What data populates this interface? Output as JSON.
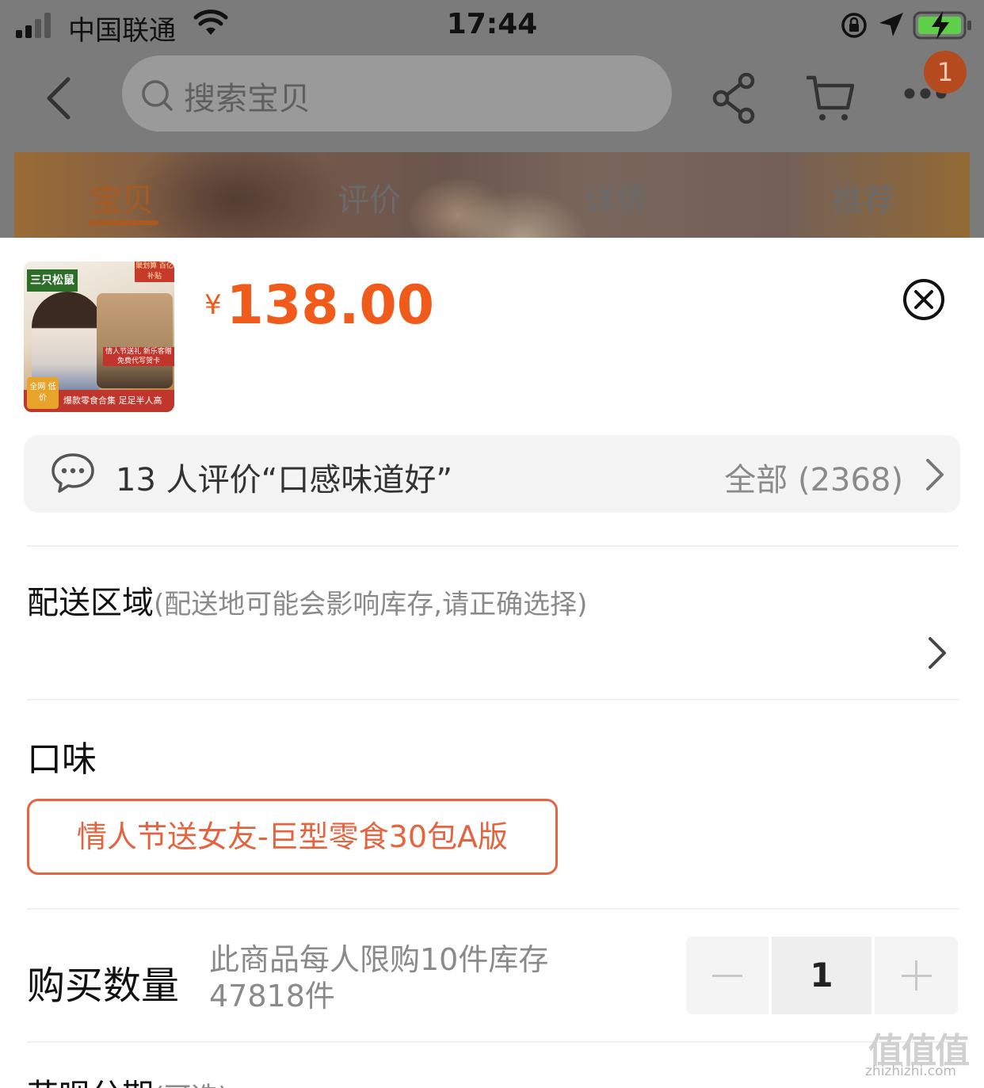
{
  "status_bar": {
    "carrier": "中国联通",
    "time": "17:44"
  },
  "nav": {
    "search_placeholder": "搜索宝贝",
    "badge_count": "1"
  },
  "tabs": [
    {
      "label": "宝贝",
      "active": true
    },
    {
      "label": "评价",
      "active": false
    },
    {
      "label": "详情",
      "active": false
    },
    {
      "label": "推荐",
      "active": false
    }
  ],
  "product": {
    "thumb_brand": "三只松鼠",
    "thumb_subsidy": "聚划算 百亿补贴",
    "thumb_bag_text": "情人节送礼 新乐客赠 免费代写贺卡",
    "thumb_tag": "全网 低价",
    "thumb_footer": "爆款零食合集 足足半人高",
    "price_symbol": "¥",
    "price": "138.00"
  },
  "review": {
    "summary": "13 人评价“口感味道好”",
    "all_label": "全部 (2368)"
  },
  "delivery": {
    "title": "配送区域",
    "hint": "(配送地可能会影响库存,请正确选择)"
  },
  "flavor": {
    "title": "口味",
    "selected_option": "情人节送女友-巨型零食30包A版"
  },
  "quantity": {
    "title": "购买数量",
    "limit_text": "此商品每人限购10件库存47818件",
    "value": "1"
  },
  "installment": {
    "title": "花呗分期",
    "hint": "(可选)"
  },
  "watermark": {
    "glyphs": "值值值",
    "site": "zhizhizhi.com"
  },
  "colors": {
    "accent": "#f05a1a",
    "option_border": "#e4643f",
    "overlay": "#8c8c8c"
  }
}
